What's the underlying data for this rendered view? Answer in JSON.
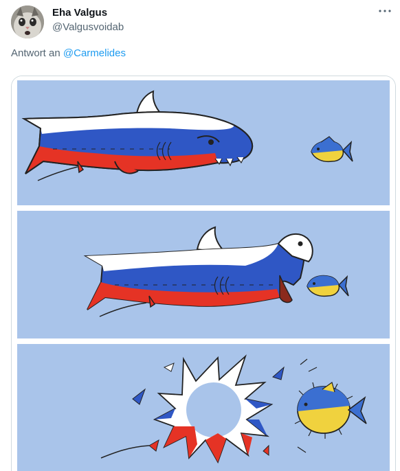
{
  "tweet": {
    "author_name": "Eha Valgus",
    "author_handle": "@Valgusvoidab",
    "more_icon": "more-horizontal-icon",
    "reply_prefix": "Antwort an",
    "reply_mention": "@Carmelides"
  },
  "media": {
    "type": "comic",
    "panels": 3,
    "colors": {
      "background": "#a9c4ea",
      "russia_white": "#ffffff",
      "russia_blue": "#2f57c5",
      "russia_red": "#e53325",
      "ukraine_blue": "#3b6fd1",
      "ukraine_yellow": "#f0d23e"
    }
  }
}
